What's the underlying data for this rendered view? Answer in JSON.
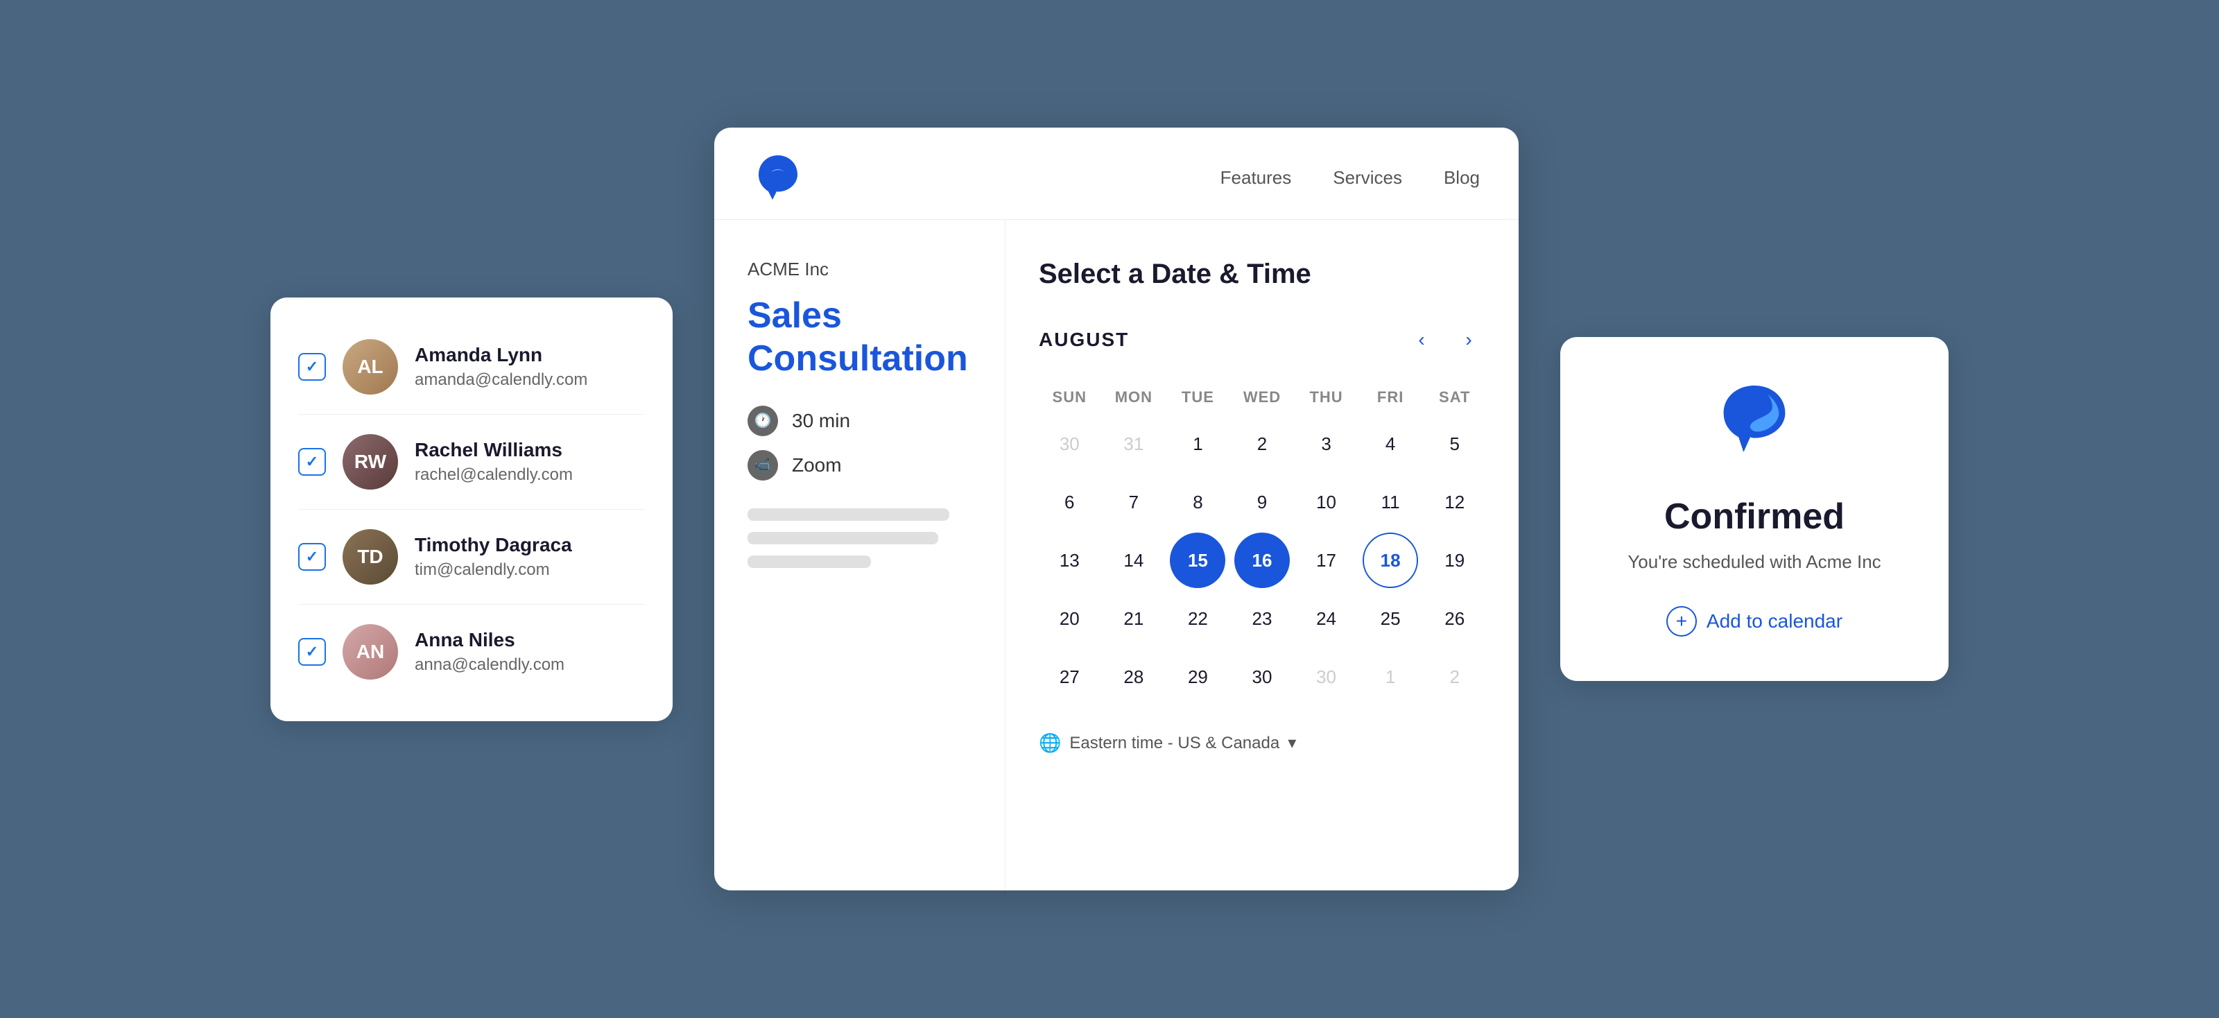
{
  "people_panel": {
    "people": [
      {
        "id": "al",
        "name": "Amanda Lynn",
        "email": "amanda@calendly.com",
        "avatar_class": "avatar-al",
        "initials": "AL"
      },
      {
        "id": "rw",
        "name": "Rachel Williams",
        "email": "rachel@calendly.com",
        "avatar_class": "avatar-rw",
        "initials": "RW"
      },
      {
        "id": "td",
        "name": "Timothy Dagraca",
        "email": "tim@calendly.com",
        "avatar_class": "avatar-td",
        "initials": "TD"
      },
      {
        "id": "an",
        "name": "Anna Niles",
        "email": "anna@calendly.com",
        "avatar_class": "avatar-an",
        "initials": "AN"
      }
    ]
  },
  "nav": {
    "links": [
      {
        "label": "Features"
      },
      {
        "label": "Services"
      },
      {
        "label": "Blog"
      }
    ]
  },
  "event": {
    "company": "ACME Inc",
    "title": "Sales Consultation",
    "duration": "30 min",
    "platform": "Zoom"
  },
  "calendar": {
    "heading": "Select a Date & Time",
    "month": "AUGUST",
    "days_of_week": [
      "SUN",
      "MON",
      "TUE",
      "WED",
      "THU",
      "FRI",
      "SAT"
    ],
    "rows": [
      [
        {
          "num": "30",
          "type": "inactive"
        },
        {
          "num": "31",
          "type": "inactive"
        },
        {
          "num": "1",
          "type": "available"
        },
        {
          "num": "2",
          "type": "available"
        },
        {
          "num": "3",
          "type": "available"
        },
        {
          "num": "4",
          "type": "available"
        },
        {
          "num": "5",
          "type": "available"
        }
      ],
      [
        {
          "num": "6",
          "type": "available"
        },
        {
          "num": "7",
          "type": "available"
        },
        {
          "num": "8",
          "type": "available"
        },
        {
          "num": "9",
          "type": "available"
        },
        {
          "num": "10",
          "type": "available"
        },
        {
          "num": "11",
          "type": "available"
        },
        {
          "num": "12",
          "type": "available"
        }
      ],
      [
        {
          "num": "13",
          "type": "available"
        },
        {
          "num": "14",
          "type": "available"
        },
        {
          "num": "15",
          "type": "highlighted"
        },
        {
          "num": "16",
          "type": "highlighted"
        },
        {
          "num": "17",
          "type": "available"
        },
        {
          "num": "18",
          "type": "outlined"
        },
        {
          "num": "19",
          "type": "available"
        }
      ],
      [
        {
          "num": "20",
          "type": "available"
        },
        {
          "num": "21",
          "type": "available"
        },
        {
          "num": "22",
          "type": "available"
        },
        {
          "num": "23",
          "type": "available"
        },
        {
          "num": "24",
          "type": "available"
        },
        {
          "num": "25",
          "type": "available"
        },
        {
          "num": "26",
          "type": "available"
        }
      ],
      [
        {
          "num": "27",
          "type": "available"
        },
        {
          "num": "28",
          "type": "available"
        },
        {
          "num": "29",
          "type": "available"
        },
        {
          "num": "30",
          "type": "available"
        },
        {
          "num": "30",
          "type": "inactive"
        },
        {
          "num": "1",
          "type": "inactive"
        },
        {
          "num": "2",
          "type": "inactive"
        }
      ]
    ],
    "timezone": "Eastern time - US & Canada"
  },
  "confirmed": {
    "title": "Confirmed",
    "subtitle": "You're scheduled with Acme Inc",
    "add_to_calendar_label": "Add to calendar"
  }
}
